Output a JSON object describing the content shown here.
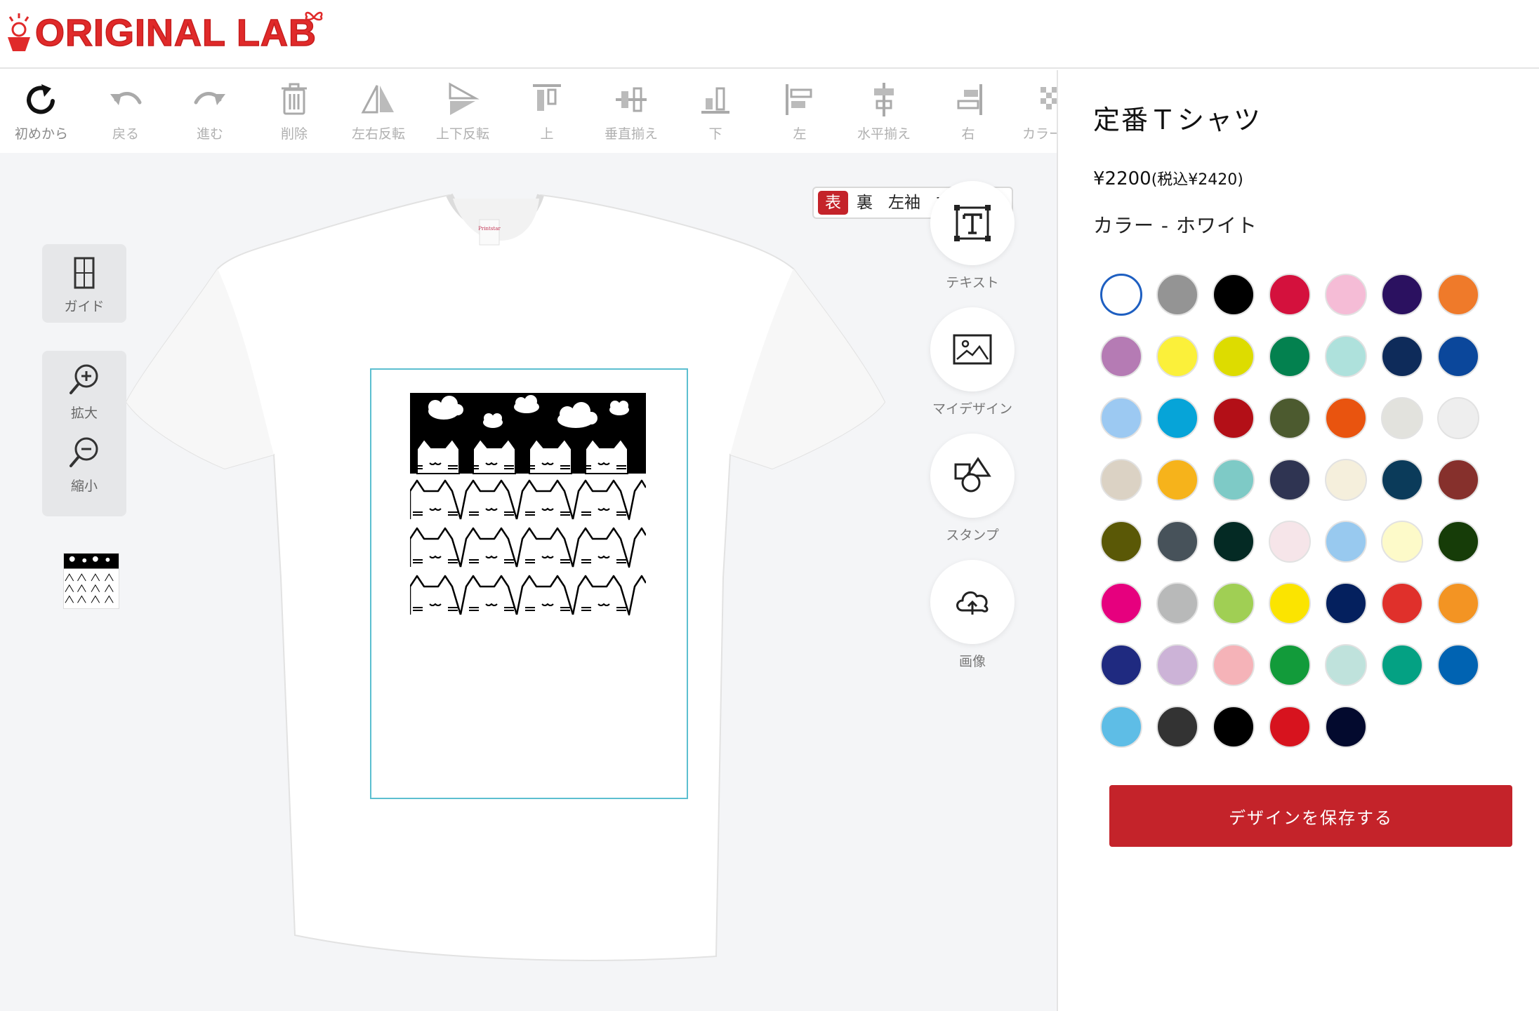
{
  "header": {
    "logo_text": "ORIGINAL LAB"
  },
  "toolbar": [
    {
      "id": "restart",
      "label": "初めから",
      "icon": "redo-circle-icon"
    },
    {
      "id": "undo",
      "label": "戻る",
      "icon": "undo-icon"
    },
    {
      "id": "redo",
      "label": "進む",
      "icon": "redo-icon"
    },
    {
      "id": "delete",
      "label": "削除",
      "icon": "trash-icon"
    },
    {
      "id": "flip-h",
      "label": "左右反転",
      "icon": "flip-horizontal-icon"
    },
    {
      "id": "flip-v",
      "label": "上下反転",
      "icon": "flip-vertical-icon"
    },
    {
      "id": "align-top",
      "label": "上",
      "icon": "align-top-icon"
    },
    {
      "id": "align-vcenter",
      "label": "垂直揃え",
      "icon": "align-vertical-center-icon"
    },
    {
      "id": "align-bottom",
      "label": "下",
      "icon": "align-bottom-icon"
    },
    {
      "id": "align-left",
      "label": "左",
      "icon": "align-left-icon"
    },
    {
      "id": "align-hcenter",
      "label": "水平揃え",
      "icon": "align-horizontal-center-icon"
    },
    {
      "id": "align-right",
      "label": "右",
      "icon": "align-right-icon"
    },
    {
      "id": "color",
      "label": "カラー選",
      "icon": "checker-icon"
    }
  ],
  "view_tabs": [
    {
      "label": "表",
      "active": true
    },
    {
      "label": "裏",
      "active": false
    },
    {
      "label": "左袖",
      "active": false
    },
    {
      "label": "右袖",
      "active": false
    }
  ],
  "left_tools": {
    "guide": "ガイド",
    "zoom_in": "拡大",
    "zoom_out": "縮小"
  },
  "side_tools": {
    "text": "テキスト",
    "my_design": "マイデザイン",
    "stamp": "スタンプ",
    "image": "画像"
  },
  "product": {
    "name": "定番Ｔシャツ",
    "price": "¥2200",
    "price_tax": "(税込¥2420)",
    "color_label": "カラー - ホワイト",
    "selected_color": "#ffffff"
  },
  "colors": [
    "#ffffff",
    "#949494",
    "#000000",
    "#d4113d",
    "#f5bcd6",
    "#2b1160",
    "#ef7a2a",
    "#b57bb4",
    "#fbf03a",
    "#dddc00",
    "#03814f",
    "#aee1dc",
    "#0e2b5a",
    "#0b479b",
    "#9cc9f2",
    "#06a4d8",
    "#b30f17",
    "#4c5a2f",
    "#e9540f",
    "#e2e2dd",
    "#eeeeee",
    "#dbd2c4",
    "#f6b31b",
    "#7ecac6",
    "#2f3452",
    "#f5efdc",
    "#0b3b5a",
    "#86302c",
    "#5a5806",
    "#47525a",
    "#042a24",
    "#f6e5e9",
    "#98c9ef",
    "#fdfac9",
    "#163c08",
    "#e6007e",
    "#b8b9b9",
    "#a0cf54",
    "#fbe400",
    "#04205e",
    "#e0302b",
    "#f39423",
    "#1f2a80",
    "#ccb3d7",
    "#f5b3b8",
    "#129b3a",
    "#bfe2dc",
    "#04a183",
    "#0063b2",
    "#5ebde6",
    "#333333",
    "#000000",
    "#d7131e",
    "#030a2e"
  ],
  "save_button": "デザインを保存する"
}
